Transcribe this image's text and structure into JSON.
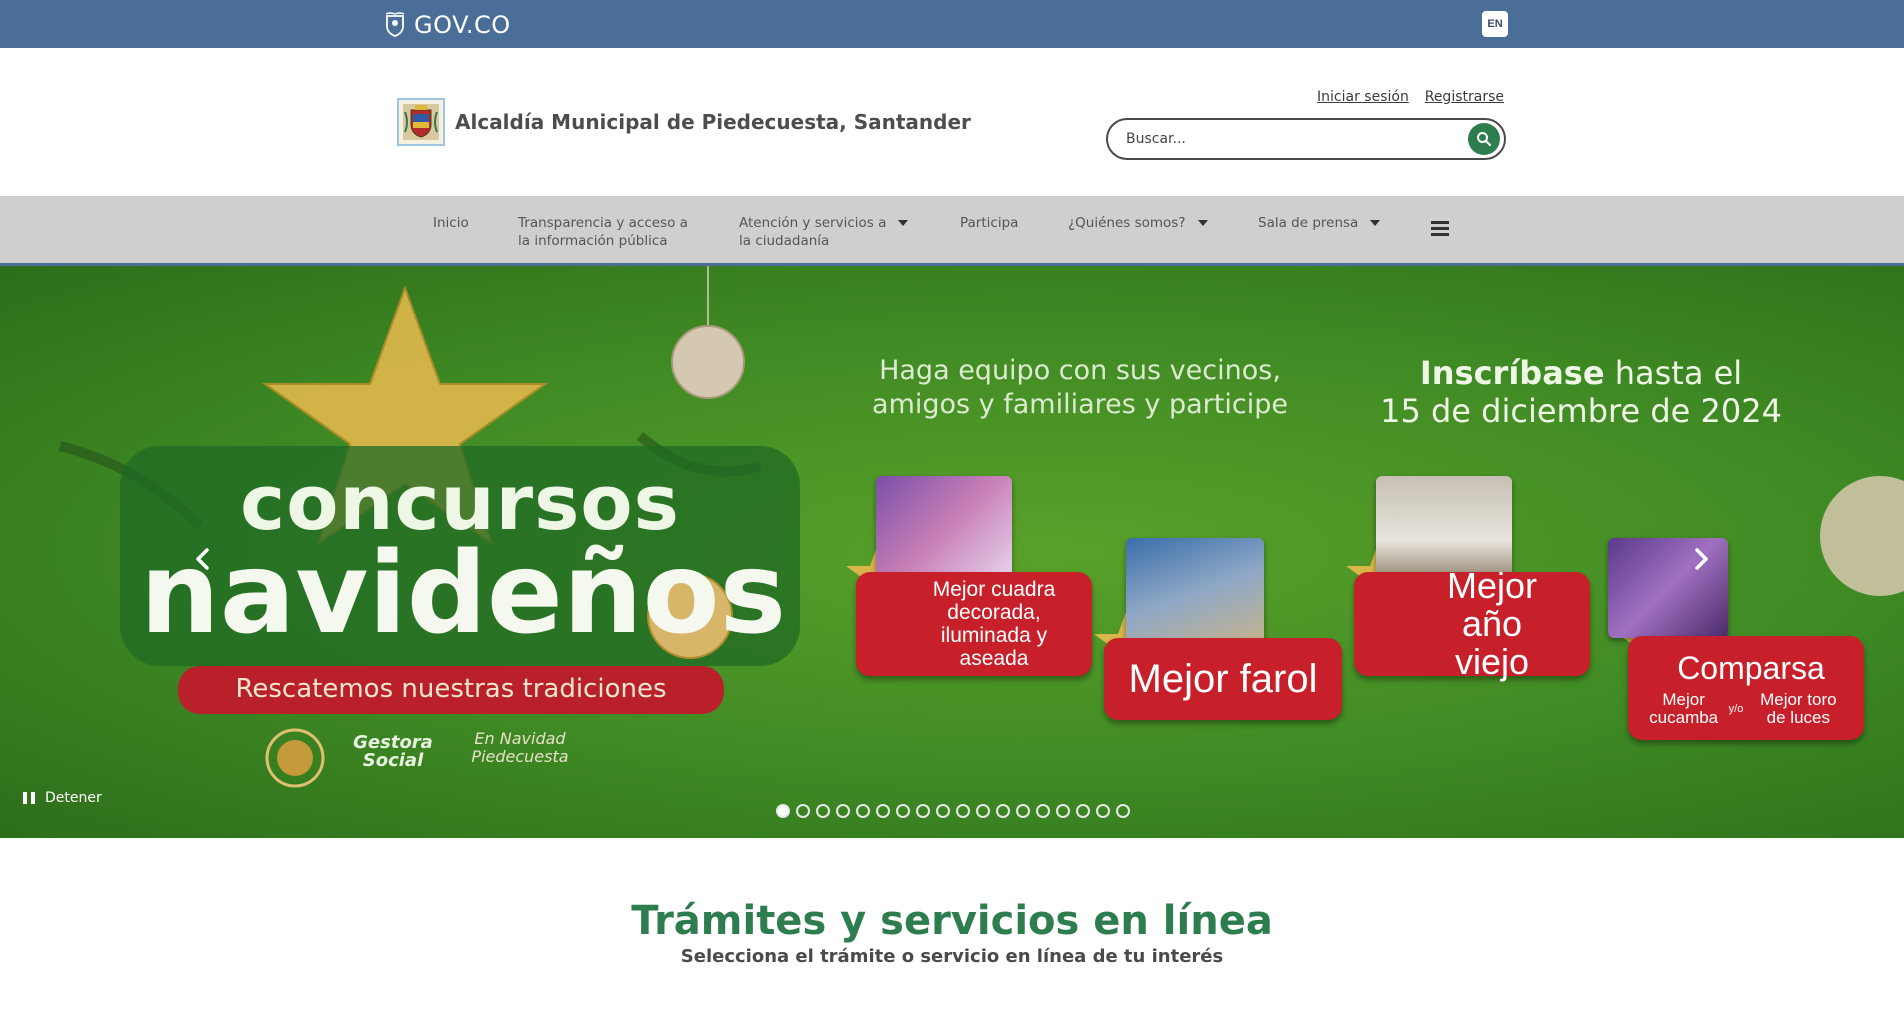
{
  "govbar": {
    "logo_text": "GOV.CO",
    "lang_label": "EN"
  },
  "header": {
    "site_title": "Alcaldía Municipal de Piedecuesta, Santander",
    "login_label": "Iniciar sesión",
    "register_label": "Registrarse",
    "search_placeholder": "Buscar..."
  },
  "nav": {
    "items": [
      {
        "label_line1": "Inicio",
        "label_line2": "",
        "has_dropdown": false
      },
      {
        "label_line1": "Transparencia y acceso a",
        "label_line2": "la información pública",
        "has_dropdown": false
      },
      {
        "label_line1": "Atención y servicios a",
        "label_line2": "la ciudadanía",
        "has_dropdown": true
      },
      {
        "label_line1": "Participa",
        "label_line2": "",
        "has_dropdown": false
      },
      {
        "label_line1": "¿Quiénes somos?",
        "label_line2": "",
        "has_dropdown": true
      },
      {
        "label_line1": "Sala de prensa",
        "label_line2": "",
        "has_dropdown": true
      }
    ]
  },
  "banner": {
    "headline_line1": "Haga equipo con sus vecinos,",
    "headline_line2": "amigos y familiares y participe",
    "deadline_bold": "Inscríbase",
    "deadline_rest": " hasta el",
    "deadline_line2": "15 de diciembre de 2024",
    "brand_line1": "concursos",
    "brand_line2": "navideños",
    "brand_tagline": "Rescatemos nuestras tradiciones",
    "logo_gestora": "Gestora Social",
    "logo_navidad": "En Navidad Piedecuesta",
    "categories": [
      {
        "label": "Mejor cuadra decorada, iluminada y aseada"
      },
      {
        "label": "Mejor farol"
      },
      {
        "label": "Mejor año viejo"
      },
      {
        "label": "Comparsa"
      }
    ],
    "comparsa_sub1": "Mejor cucamba",
    "comparsa_sub_mid": "y/o",
    "comparsa_sub2": "Mejor toro de luces",
    "pause_label": "Detener",
    "slide_count": 18,
    "active_slide": 1
  },
  "section": {
    "title": "Trámites y servicios en línea",
    "subtitle": "Selecciona el trámite o servicio en línea de tu interés"
  },
  "colors": {
    "govbar": "#4a6e97",
    "accent_green": "#2e7d4f",
    "nav_bg": "#cfcfcf",
    "banner_green": "#4a9526",
    "card_red": "#c7202b"
  }
}
